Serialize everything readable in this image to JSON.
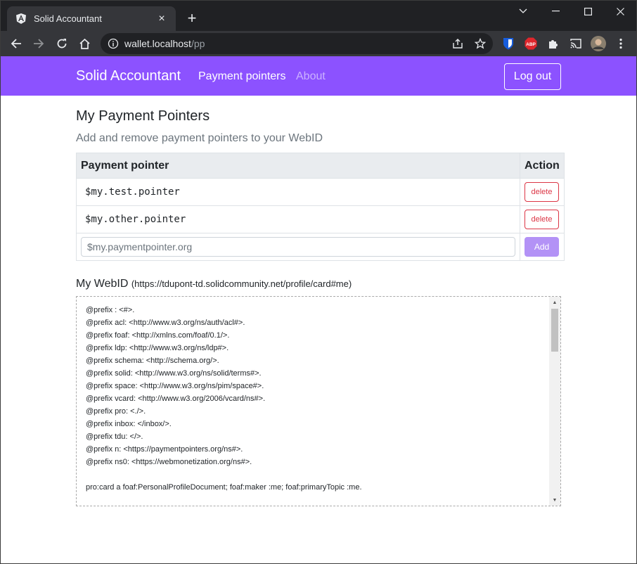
{
  "browser": {
    "tab_title": "Solid Accountant",
    "tab_close": "×",
    "new_tab": "+",
    "url_host": "wallet.localhost",
    "url_path": "/pp",
    "icons": [
      "back-icon",
      "forward-icon",
      "reload-icon",
      "home-icon",
      "site-info-icon",
      "share-icon",
      "star-icon",
      "bitwarden-icon",
      "adblock-icon",
      "extensions-icon",
      "cast-icon",
      "profile-avatar",
      "menu-icon"
    ],
    "adblock_label": "ABP"
  },
  "navbar": {
    "brand": "Solid Accountant",
    "links": [
      {
        "label": "Payment pointers",
        "active": true
      },
      {
        "label": "About",
        "active": false
      }
    ],
    "logout_label": "Log out",
    "color": "#8c52ff"
  },
  "main": {
    "title": "My Payment Pointers",
    "subtitle": "Add and remove payment pointers to your WebID",
    "table": {
      "headers": [
        "Payment pointer",
        "Action"
      ],
      "rows": [
        {
          "pointer": "$my.test.pointer",
          "action": "delete"
        },
        {
          "pointer": "$my.other.pointer",
          "action": "delete"
        }
      ],
      "input_placeholder": "$my.paymentpointer.org",
      "add_label": "Add"
    },
    "webid": {
      "label": "My WebID",
      "url": "(https://tdupont-td.solidcommunity.net/profile/card#me)"
    },
    "turtle_lines": [
      "@prefix : <#>.",
      "@prefix acl: <http://www.w3.org/ns/auth/acl#>.",
      "@prefix foaf: <http://xmlns.com/foaf/0.1/>.",
      "@prefix ldp: <http://www.w3.org/ns/ldp#>.",
      "@prefix schema: <http://schema.org/>.",
      "@prefix solid: <http://www.w3.org/ns/solid/terms#>.",
      "@prefix space: <http://www.w3.org/ns/pim/space#>.",
      "@prefix vcard: <http://www.w3.org/2006/vcard/ns#>.",
      "@prefix pro: <./>.",
      "@prefix inbox: </inbox/>.",
      "@prefix tdu: </>.",
      "@prefix n: <https://paymentpointers.org/ns#>.",
      "@prefix ns0: <https://webmonetization.org/ns#>.",
      "",
      "pro:card a foaf:PersonalProfileDocument; foaf:maker :me; foaf:primaryTopic :me."
    ]
  }
}
